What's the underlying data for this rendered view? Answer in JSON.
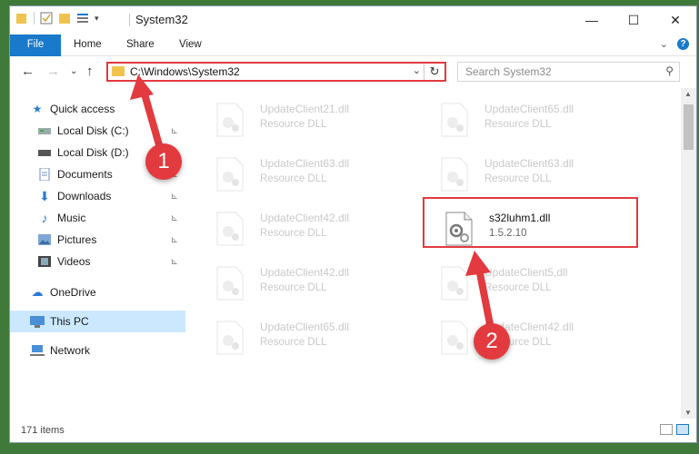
{
  "window": {
    "title": "System32",
    "controls": {
      "minimize": "—",
      "maximize": "☐",
      "close": "✕"
    }
  },
  "ribbon": {
    "tabs": [
      "File",
      "Home",
      "Share",
      "View"
    ]
  },
  "nav": {
    "back": "←",
    "forward": "→",
    "recent": "⌄",
    "up": "↑",
    "address": "C:\\Windows\\System32",
    "search_placeholder": "Search System32"
  },
  "sidebar": {
    "quick_access": "Quick access",
    "items": [
      {
        "label": "Local Disk (C:)",
        "icon": "drive-icon",
        "pinned": true
      },
      {
        "label": "Local Disk (D:)",
        "icon": "drive-icon",
        "pinned": true
      },
      {
        "label": "Documents",
        "icon": "documents-icon",
        "pinned": true
      },
      {
        "label": "Downloads",
        "icon": "downloads-icon",
        "pinned": true
      },
      {
        "label": "Music",
        "icon": "music-icon",
        "pinned": true
      },
      {
        "label": "Pictures",
        "icon": "pictures-icon",
        "pinned": true
      },
      {
        "label": "Videos",
        "icon": "videos-icon",
        "pinned": true
      }
    ],
    "onedrive": "OneDrive",
    "this_pc": "This PC",
    "network": "Network"
  },
  "files": [
    {
      "name": "UpdateClient21.dll",
      "type": "Resource DLL"
    },
    {
      "name": "UpdateClient65.dll",
      "type": "Resource DLL"
    },
    {
      "name": "UpdateClient63.dll",
      "type": "Resource DLL"
    },
    {
      "name": "UpdateClient63.dll",
      "type": "Resource DLL"
    },
    {
      "name": "UpdateClient42.dll",
      "type": "Resource DLL"
    },
    {
      "name": "s32luhm1.dll",
      "type": "1.5.2.10"
    },
    {
      "name": "UpdateClient42.dll",
      "type": "Resource DLL"
    },
    {
      "name": "UpdateClient5.dll",
      "type": "Resource DLL"
    },
    {
      "name": "UpdateClient65.dll",
      "type": "Resource DLL"
    },
    {
      "name": "UpdateClient42.dll",
      "type": "Resource DLL"
    }
  ],
  "status": {
    "count": "171 items"
  },
  "markers": [
    "1",
    "2"
  ],
  "colors": {
    "accent": "#1979ca",
    "highlight": "#e23a3e",
    "selected_bg": "#cce8ff"
  }
}
